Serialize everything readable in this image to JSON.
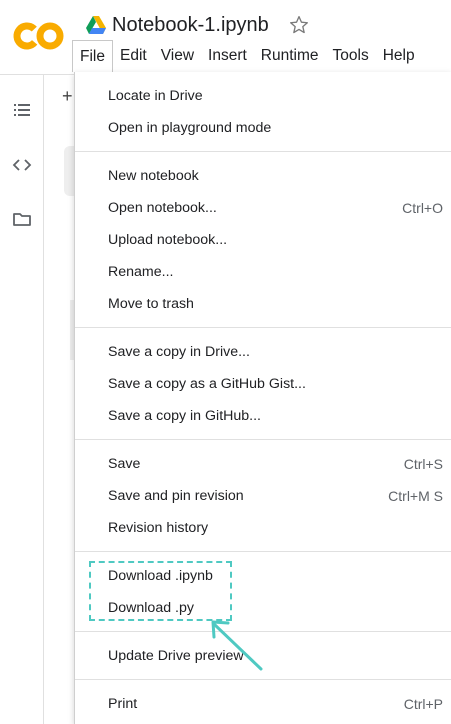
{
  "header": {
    "logo_text": "CO",
    "doc_title": "Notebook-1.ipynb",
    "menubar": [
      "File",
      "Edit",
      "View",
      "Insert",
      "Runtime",
      "Tools",
      "Help"
    ]
  },
  "rail": {
    "icons": [
      "toc-icon",
      "code-icon",
      "folder-icon"
    ]
  },
  "background": {
    "plus": "+"
  },
  "file_menu": {
    "groups": [
      [
        {
          "label": "Locate in Drive",
          "shortcut": ""
        },
        {
          "label": "Open in playground mode",
          "shortcut": ""
        }
      ],
      [
        {
          "label": "New notebook",
          "shortcut": ""
        },
        {
          "label": "Open notebook...",
          "shortcut": "Ctrl+O"
        },
        {
          "label": "Upload notebook...",
          "shortcut": ""
        },
        {
          "label": "Rename...",
          "shortcut": ""
        },
        {
          "label": "Move to trash",
          "shortcut": ""
        }
      ],
      [
        {
          "label": "Save a copy in Drive...",
          "shortcut": ""
        },
        {
          "label": "Save a copy as a GitHub Gist...",
          "shortcut": ""
        },
        {
          "label": "Save a copy in GitHub...",
          "shortcut": ""
        }
      ],
      [
        {
          "label": "Save",
          "shortcut": "Ctrl+S"
        },
        {
          "label": "Save and pin revision",
          "shortcut": "Ctrl+M S"
        },
        {
          "label": "Revision history",
          "shortcut": ""
        }
      ],
      [
        {
          "label": "Download .ipynb",
          "shortcut": ""
        },
        {
          "label": "Download .py",
          "shortcut": ""
        }
      ],
      [
        {
          "label": "Update Drive preview",
          "shortcut": ""
        }
      ],
      [
        {
          "label": "Print",
          "shortcut": "Ctrl+P"
        }
      ]
    ]
  },
  "colors": {
    "logo_orange": "#f9ab00",
    "highlight_teal": "#4fc9c2",
    "drive_green": "#0f9d58",
    "drive_yellow": "#f4b400",
    "drive_blue": "#4285f4"
  }
}
